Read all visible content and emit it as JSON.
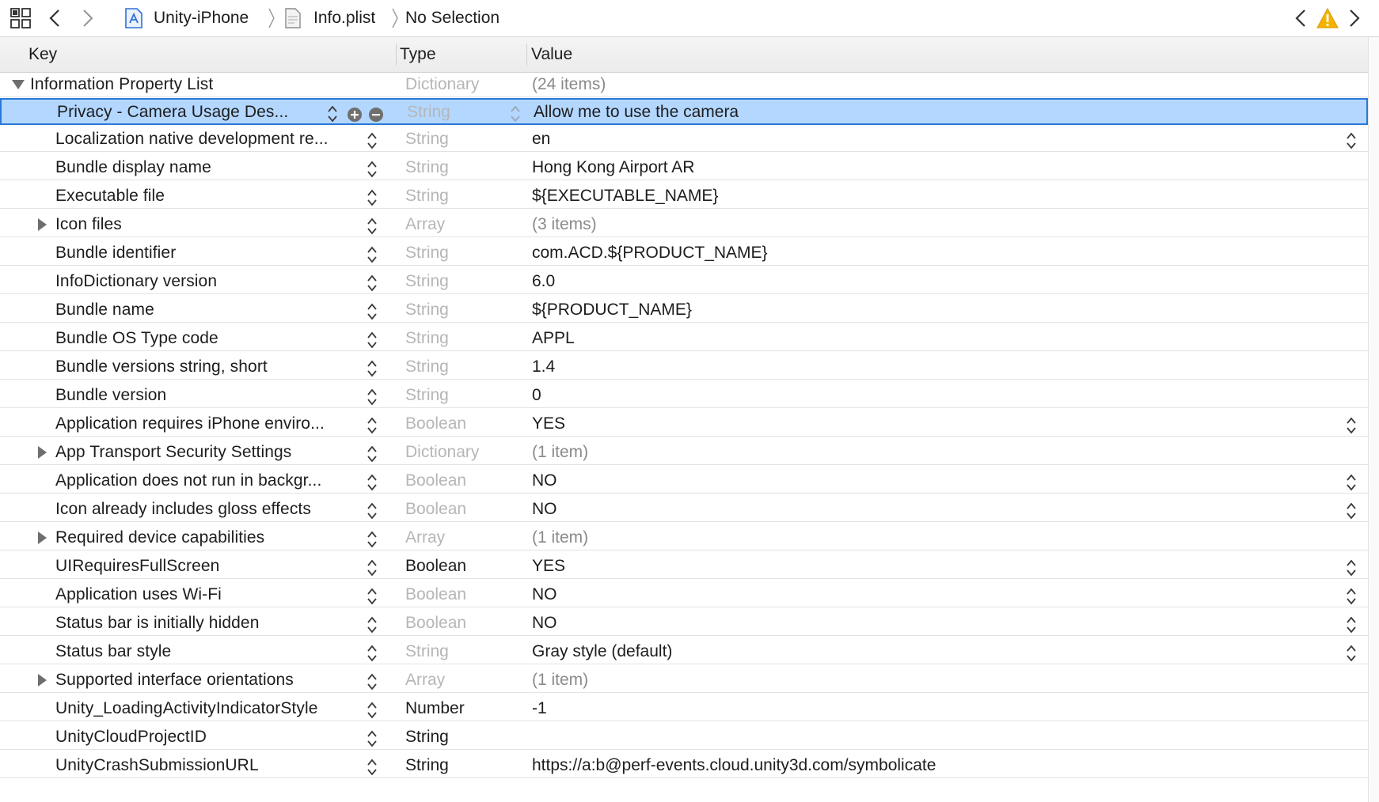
{
  "jumpbar": {
    "crumbs": [
      "Unity-iPhone",
      "Info.plist",
      "No Selection"
    ],
    "icons": [
      "related-items-icon",
      "back-icon",
      "forward-icon",
      "project-icon",
      "plist-file-icon",
      "previous-issue-icon",
      "warning-icon",
      "next-issue-icon"
    ],
    "warning_color": "#f5b300"
  },
  "table": {
    "columns": [
      "Key",
      "Type",
      "Value"
    ],
    "root": {
      "key": "Information Property List",
      "type": "Dictionary",
      "value": "(24 items)",
      "expanded": true
    },
    "rows": [
      {
        "key": "Privacy - Camera Usage Des...",
        "type": "String",
        "value": "Allow me to use the camera",
        "selected": true,
        "expandable": false,
        "type_dim": true,
        "value_dim": false,
        "value_popup": false
      },
      {
        "key": "Localization native development re...",
        "type": "String",
        "value": "en",
        "selected": false,
        "expandable": false,
        "type_dim": true,
        "value_dim": false,
        "value_popup": true
      },
      {
        "key": "Bundle display name",
        "type": "String",
        "value": "Hong Kong Airport AR",
        "selected": false,
        "expandable": false,
        "type_dim": true,
        "value_dim": false,
        "value_popup": false
      },
      {
        "key": "Executable file",
        "type": "String",
        "value": "${EXECUTABLE_NAME}",
        "selected": false,
        "expandable": false,
        "type_dim": true,
        "value_dim": false,
        "value_popup": false
      },
      {
        "key": "Icon files",
        "type": "Array",
        "value": "(3 items)",
        "selected": false,
        "expandable": true,
        "type_dim": true,
        "value_dim": true,
        "value_popup": false
      },
      {
        "key": "Bundle identifier",
        "type": "String",
        "value": "com.ACD.${PRODUCT_NAME}",
        "selected": false,
        "expandable": false,
        "type_dim": true,
        "value_dim": false,
        "value_popup": false
      },
      {
        "key": "InfoDictionary version",
        "type": "String",
        "value": "6.0",
        "selected": false,
        "expandable": false,
        "type_dim": true,
        "value_dim": false,
        "value_popup": false
      },
      {
        "key": "Bundle name",
        "type": "String",
        "value": "${PRODUCT_NAME}",
        "selected": false,
        "expandable": false,
        "type_dim": true,
        "value_dim": false,
        "value_popup": false
      },
      {
        "key": "Bundle OS Type code",
        "type": "String",
        "value": "APPL",
        "selected": false,
        "expandable": false,
        "type_dim": true,
        "value_dim": false,
        "value_popup": false
      },
      {
        "key": "Bundle versions string, short",
        "type": "String",
        "value": "1.4",
        "selected": false,
        "expandable": false,
        "type_dim": true,
        "value_dim": false,
        "value_popup": false
      },
      {
        "key": "Bundle version",
        "type": "String",
        "value": "0",
        "selected": false,
        "expandable": false,
        "type_dim": true,
        "value_dim": false,
        "value_popup": false
      },
      {
        "key": "Application requires iPhone enviro...",
        "type": "Boolean",
        "value": "YES",
        "selected": false,
        "expandable": false,
        "type_dim": true,
        "value_dim": false,
        "value_popup": true
      },
      {
        "key": "App Transport Security Settings",
        "type": "Dictionary",
        "value": "(1 item)",
        "selected": false,
        "expandable": true,
        "type_dim": true,
        "value_dim": true,
        "value_popup": false
      },
      {
        "key": "Application does not run in backgr...",
        "type": "Boolean",
        "value": "NO",
        "selected": false,
        "expandable": false,
        "type_dim": true,
        "value_dim": false,
        "value_popup": true
      },
      {
        "key": "Icon already includes gloss effects",
        "type": "Boolean",
        "value": "NO",
        "selected": false,
        "expandable": false,
        "type_dim": true,
        "value_dim": false,
        "value_popup": true
      },
      {
        "key": "Required device capabilities",
        "type": "Array",
        "value": "(1 item)",
        "selected": false,
        "expandable": true,
        "type_dim": true,
        "value_dim": true,
        "value_popup": false
      },
      {
        "key": "UIRequiresFullScreen",
        "type": "Boolean",
        "value": "YES",
        "selected": false,
        "expandable": false,
        "type_dim": false,
        "value_dim": false,
        "value_popup": true
      },
      {
        "key": "Application uses Wi-Fi",
        "type": "Boolean",
        "value": "NO",
        "selected": false,
        "expandable": false,
        "type_dim": true,
        "value_dim": false,
        "value_popup": true
      },
      {
        "key": "Status bar is initially hidden",
        "type": "Boolean",
        "value": "NO",
        "selected": false,
        "expandable": false,
        "type_dim": true,
        "value_dim": false,
        "value_popup": true
      },
      {
        "key": "Status bar style",
        "type": "String",
        "value": "Gray style (default)",
        "selected": false,
        "expandable": false,
        "type_dim": true,
        "value_dim": false,
        "value_popup": true
      },
      {
        "key": "Supported interface orientations",
        "type": "Array",
        "value": "(1 item)",
        "selected": false,
        "expandable": true,
        "type_dim": true,
        "value_dim": true,
        "value_popup": false
      },
      {
        "key": "Unity_LoadingActivityIndicatorStyle",
        "type": "Number",
        "value": "-1",
        "selected": false,
        "expandable": false,
        "type_dim": false,
        "value_dim": false,
        "value_popup": false
      },
      {
        "key": "UnityCloudProjectID",
        "type": "String",
        "value": "",
        "selected": false,
        "expandable": false,
        "type_dim": false,
        "value_dim": false,
        "value_popup": false
      },
      {
        "key": "UnityCrashSubmissionURL",
        "type": "String",
        "value": "https://a:b@perf-events.cloud.unity3d.com/symbolicate",
        "selected": false,
        "expandable": false,
        "type_dim": false,
        "value_dim": false,
        "value_popup": false
      }
    ]
  },
  "colors": {
    "selection": "#b3d7ff",
    "selection_border": "#2a78d6",
    "dim_type": "#b6b6b6",
    "dim_value": "#8a8a8a"
  }
}
